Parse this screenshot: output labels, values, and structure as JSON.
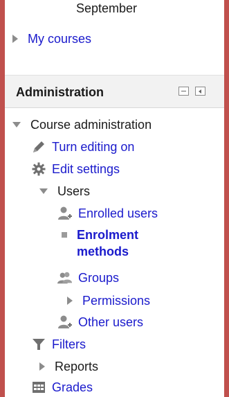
{
  "top": {
    "partial_text": "September"
  },
  "nav": {
    "my_courses": "My courses"
  },
  "admin_block": {
    "title": "Administration",
    "controls": {
      "minimize": "minimize-icon",
      "dock": "dock-icon"
    }
  },
  "tree": {
    "course_admin": "Course administration",
    "turn_editing_on": "Turn editing on",
    "edit_settings": "Edit settings",
    "users": "Users",
    "enrolled_users": "Enrolled users",
    "enrolment_methods_1": "Enrolment",
    "enrolment_methods_2": "methods",
    "groups": "Groups",
    "permissions": "Permissions",
    "other_users": "Other users",
    "filters": "Filters",
    "reports": "Reports",
    "grades": "Grades"
  },
  "colors": {
    "frame": "#c0504d",
    "link": "#1a1acc",
    "text": "#1a1a1a",
    "icon_gray": "#8c8c8c"
  }
}
